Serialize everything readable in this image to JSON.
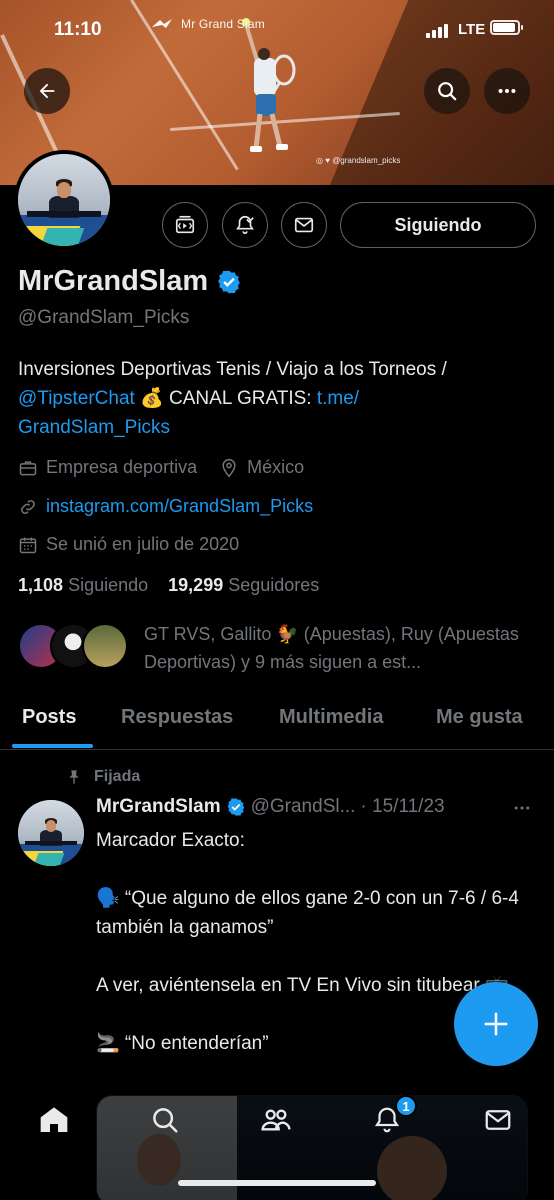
{
  "status_bar": {
    "time": "11:10",
    "network": "LTE",
    "battery_level": 0.92
  },
  "banner": {
    "brand": "Mr Grand Slam",
    "social_handle": "@grandslam_picks"
  },
  "profile": {
    "name": "MrGrandSlam",
    "handle": "@GrandSlam_Picks",
    "follow_button": "Siguiendo",
    "bio_text_1": "Inversiones Deportivas Tenis / Viajo a los Torneos /",
    "bio_mention": "@TipsterChat",
    "bio_emoji": "💰",
    "bio_text_2": "CANAL GRATIS:",
    "bio_link_1": "t.me/",
    "bio_link_2": "GrandSlam_Picks",
    "category": "Empresa deportiva",
    "location": "México",
    "website": "instagram.com/GrandSlam_Picks",
    "joined": "Se unió en julio de 2020",
    "following_count": "1,108",
    "following_label": "Siguiendo",
    "followers_count": "19,299",
    "followers_label": "Seguidores",
    "followed_by": "GT RVS, Gallito 🐓 (Apuestas), Ruy (Apuestas Deportivas) y 9 más siguen a est..."
  },
  "tabs": [
    "Posts",
    "Respuestas",
    "Multimedia",
    "Me gusta"
  ],
  "active_tab": "Posts",
  "post": {
    "pinned_label": "Fijada",
    "author_name": "MrGrandSlam",
    "author_handle": "@GrandSl...",
    "date": "· 15/11/23",
    "body": "Marcador Exacto:\n\n🗣️ “Que alguno de ellos gane 2-0 con un 7-6 / 6-4 también la ganamos”\n\nA ver, aviéntensela en TV En Vivo sin titubear 📺\n\n🚬 “No entenderían”"
  },
  "nav": {
    "notifications_badge": "1"
  },
  "colors": {
    "accent": "#1d9bf0",
    "background": "#000000",
    "muted": "#71767b",
    "text": "#e7e9ea"
  }
}
